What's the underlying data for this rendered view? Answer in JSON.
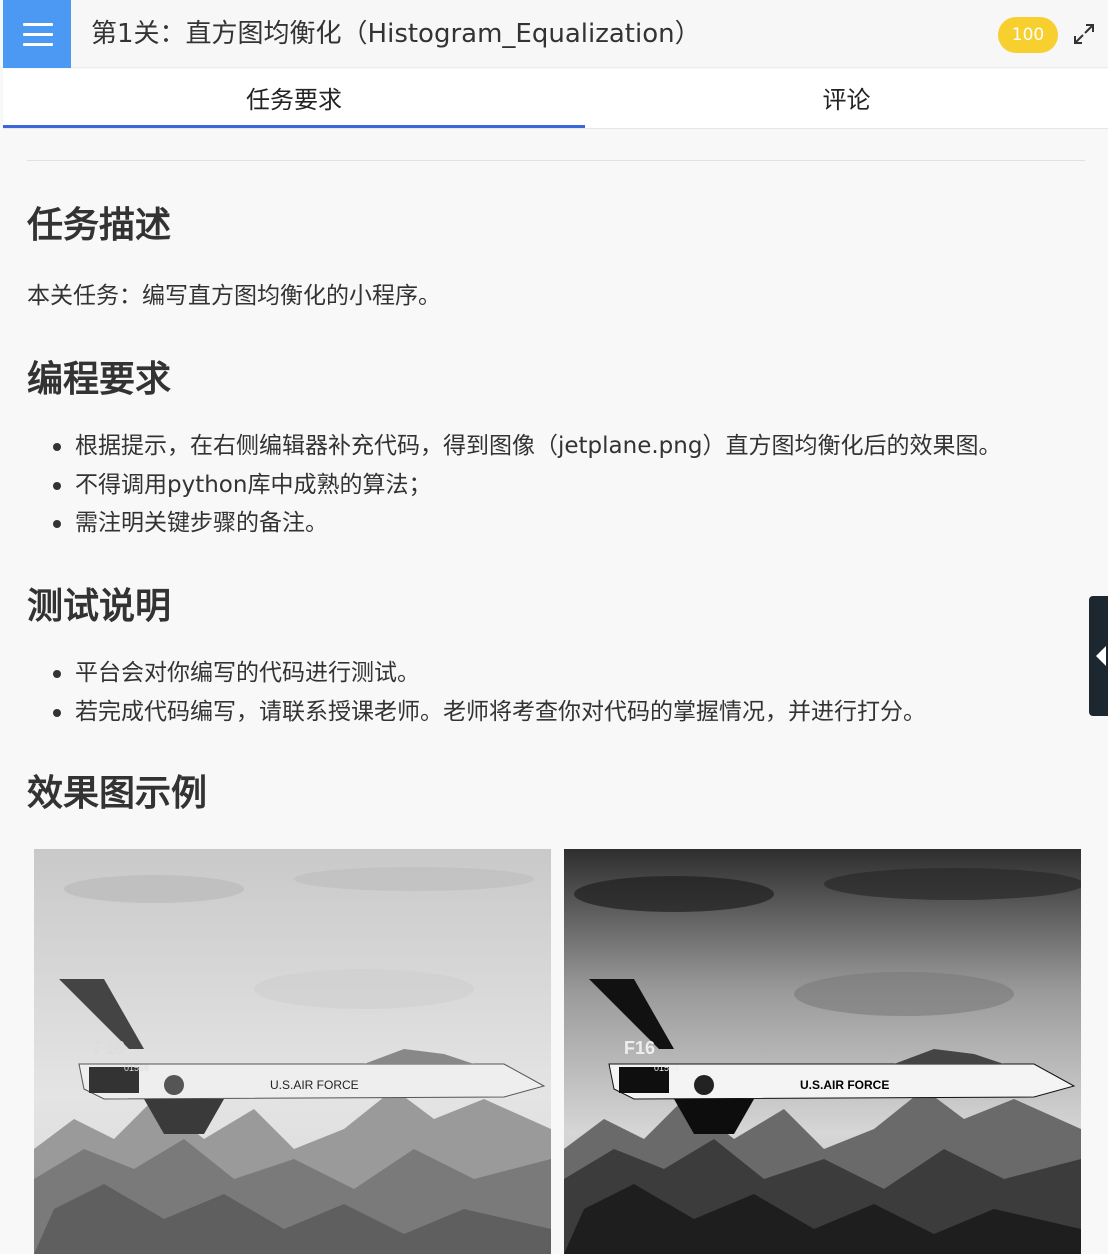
{
  "header": {
    "title": "第1关：直方图均衡化（Histogram_Equalization）",
    "score": "100",
    "menu_icon": "hamburger-menu-icon",
    "expand_icon": "fullscreen-expand-icon",
    "accent_color": "#4b99f2",
    "score_color": "#f7cf2e"
  },
  "tabs": [
    {
      "label": "任务要求",
      "active": true
    },
    {
      "label": "评论",
      "active": false
    }
  ],
  "content": {
    "sections": [
      {
        "heading": "任务描述",
        "paragraph": "本关任务：编写直方图均衡化的小程序。"
      },
      {
        "heading": "编程要求",
        "items": [
          "根据提示，在右侧编辑器补充代码，得到图像（jetplane.png）直方图均衡化后的效果图。",
          "不得调用python库中成熟的算法；",
          "需注明关键步骤的备注。"
        ]
      },
      {
        "heading": "测试说明",
        "items": [
          "平台会对你编写的代码进行测试。",
          "若完成代码编写，请联系授课老师。老师将考查你对代码的掌握情况，并进行打分。"
        ]
      },
      {
        "heading": "效果图示例"
      }
    ],
    "images": [
      {
        "name": "original",
        "aircraft_text": "U.S.AIR FORCE",
        "tail_text": "F16",
        "serial": "01568"
      },
      {
        "name": "equalized",
        "aircraft_text": "U.S.AIR FORCE",
        "tail_text": "F16",
        "serial": "01568"
      }
    ]
  },
  "side_toggle": {
    "icon": "collapse-arrow-left-icon"
  }
}
